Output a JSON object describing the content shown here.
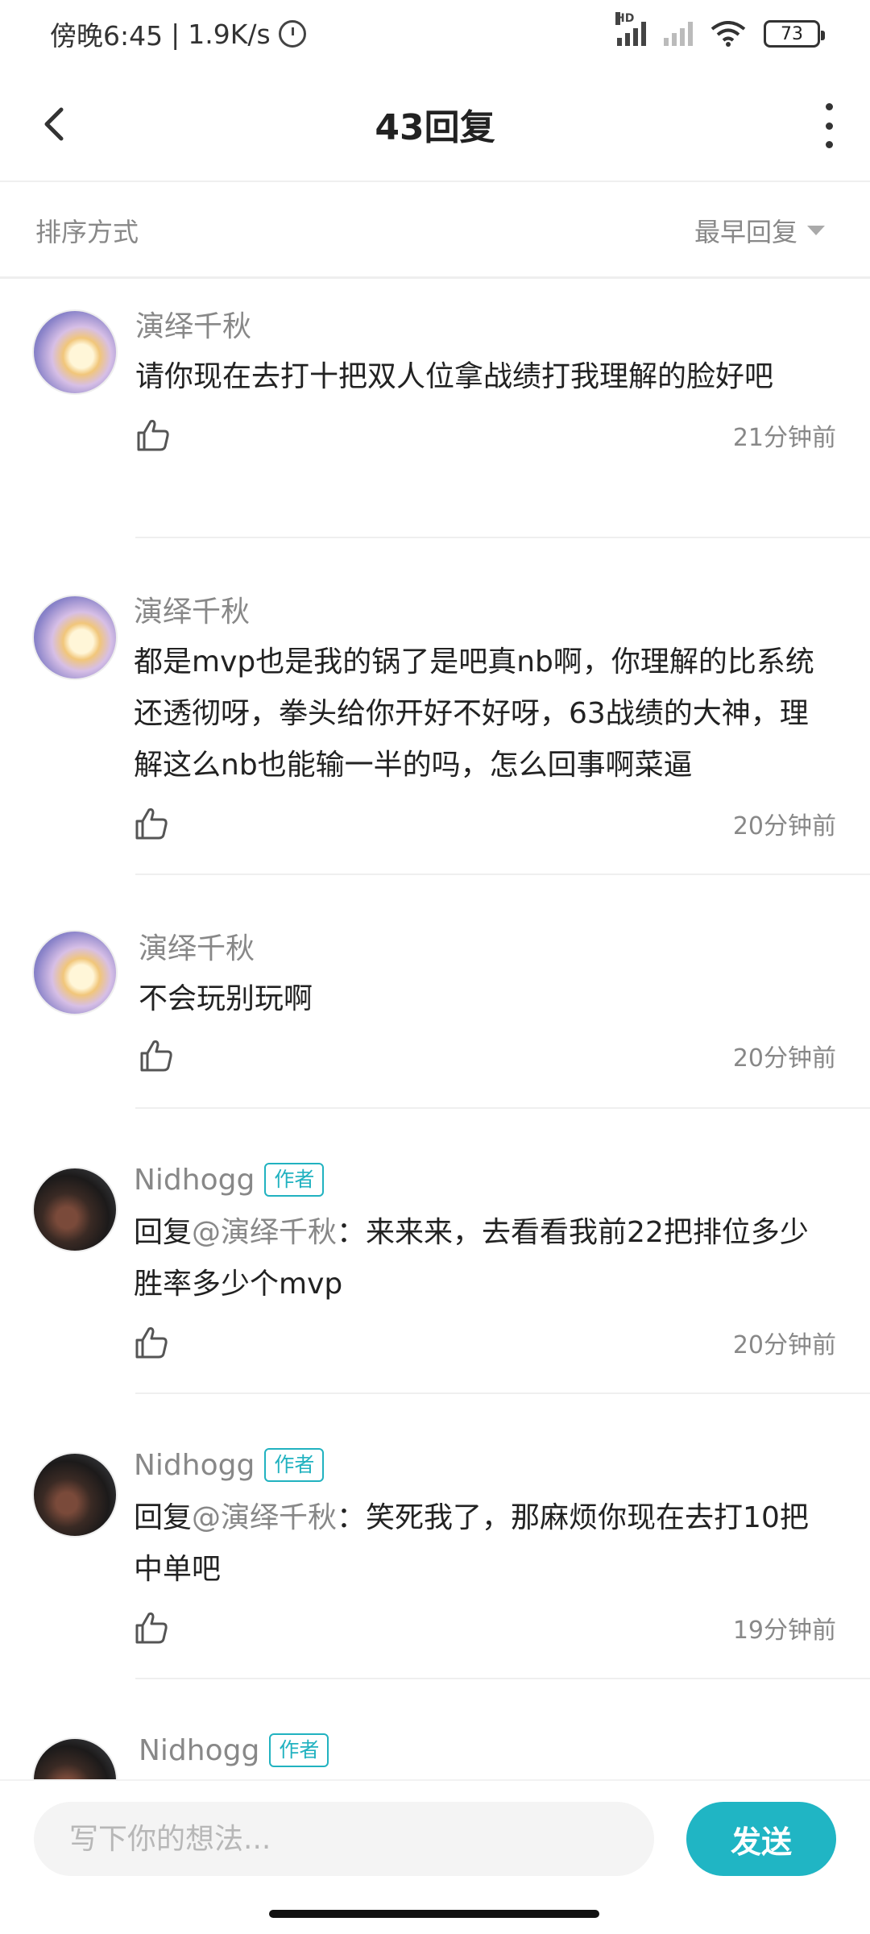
{
  "status_bar": {
    "time": "傍晚6:45",
    "separator": "|",
    "net_speed": "1.9K/s",
    "hd_label": "HD",
    "battery": "73"
  },
  "header": {
    "title": "43回复"
  },
  "sort": {
    "label": "排序方式",
    "selected": "最早回复"
  },
  "colors": {
    "accent": "#20b5c4",
    "secondary_text": "#888888"
  },
  "replies": [
    {
      "author": "演绎千秋",
      "is_author": false,
      "avatar": "sky-avatar",
      "text": "请你现在去打十把双人位拿战绩打我理解的脸好吧",
      "time": "21分钟前"
    },
    {
      "author": "演绎千秋",
      "is_author": false,
      "avatar": "sky-avatar",
      "text": "都是mvp也是我的锅了是吧真nb啊，你理解的比系统还透彻呀，拳头给你开好不好呀，63战绩的大神，理解这么nb也能输一半的吗，怎么回事啊菜逼",
      "time": "20分钟前"
    },
    {
      "author": "演绎千秋",
      "is_author": false,
      "avatar": "sky-avatar",
      "text": "不会玩别玩啊",
      "time": "20分钟前"
    },
    {
      "author": "Nidhogg",
      "is_author": true,
      "badge": "作者",
      "avatar": "dark-avatar",
      "reply_prefix": "回复",
      "mention": "@演绎千秋",
      "colon": "：",
      "text": "来来来，去看看我前22把排位多少胜率多少个mvp",
      "time": "20分钟前"
    },
    {
      "author": "Nidhogg",
      "is_author": true,
      "badge": "作者",
      "avatar": "dark-avatar",
      "reply_prefix": "回复",
      "mention": "@演绎千秋",
      "colon": "：",
      "text": "笑死我了，那麻烦你现在去打10把中单吧",
      "time": "19分钟前"
    },
    {
      "author": "Nidhogg",
      "is_author": true,
      "badge": "作者",
      "avatar": "dark-avatar"
    }
  ],
  "composer": {
    "placeholder": "写下你的想法...",
    "send_label": "发送"
  }
}
